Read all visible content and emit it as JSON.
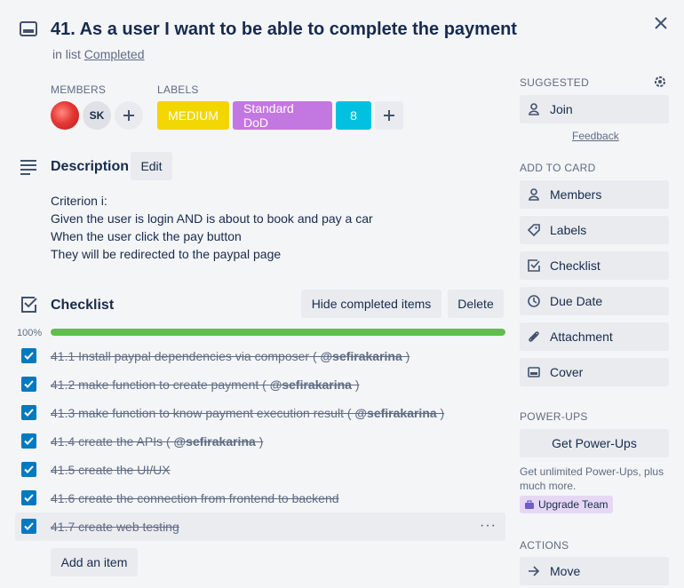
{
  "card": {
    "title": "41. As a user I want to be able to complete the payment",
    "in_list_prefix": "in list",
    "list_name": "Completed"
  },
  "members": {
    "label": "MEMBERS",
    "initials": "SK"
  },
  "labels": {
    "label": "LABELS",
    "items": [
      {
        "text": "MEDIUM",
        "color": "#f2d600"
      },
      {
        "text": "Standard DoD",
        "color": "#c377e0"
      },
      {
        "text": "8",
        "color": "#00c2e0"
      }
    ]
  },
  "description": {
    "heading": "Description",
    "edit_label": "Edit",
    "lines": [
      "Criterion i:",
      "Given the user is login AND is about to book and pay a car",
      "When the user click the pay button",
      "They will be redirected to the paypal page"
    ]
  },
  "checklist": {
    "heading": "Checklist",
    "hide_label": "Hide completed items",
    "delete_label": "Delete",
    "progress_text": "100%",
    "progress": 1.0,
    "items": [
      {
        "text": "41.1 Install paypal dependencies via composer ( ",
        "mention": "@sefirakarina",
        "suffix": " )"
      },
      {
        "text": "41.2 make function to create payment ( ",
        "mention": "@sefirakarina",
        "suffix": " )"
      },
      {
        "text": "41.3 make function to know payment execution result ( ",
        "mention": "@sefirakarina",
        "suffix": " )"
      },
      {
        "text": "41.4 create the APIs ( ",
        "mention": "@sefirakarina",
        "suffix": " )"
      },
      {
        "text": "41.5 create the UI/UX",
        "mention": "",
        "suffix": ""
      },
      {
        "text": "41.6 create the connection from frontend to backend",
        "mention": "",
        "suffix": ""
      },
      {
        "text": "41.7 create web testing",
        "mention": "",
        "suffix": ""
      }
    ],
    "add_item_label": "Add an item",
    "more_label": "···"
  },
  "sidebar": {
    "suggested_label": "SUGGESTED",
    "join_label": "Join",
    "feedback_label": "Feedback",
    "add_to_card_label": "ADD TO CARD",
    "add_items": [
      "Members",
      "Labels",
      "Checklist",
      "Due Date",
      "Attachment",
      "Cover"
    ],
    "powerups_label": "POWER-UPS",
    "get_powerups_label": "Get Power-Ups",
    "powerups_note": "Get unlimited Power-Ups, plus much more.",
    "upgrade_label": "Upgrade Team",
    "actions_label": "ACTIONS",
    "move_label": "Move"
  },
  "colors": {
    "accent": "#0079bf",
    "progress": "#61bd4f"
  }
}
